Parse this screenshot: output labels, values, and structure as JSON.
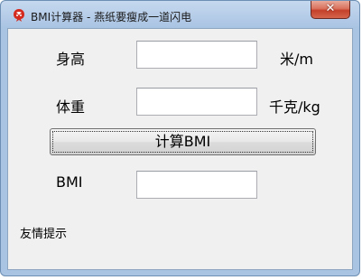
{
  "window": {
    "title": "BMI计算器 - 燕纸要瘦成一道闪电",
    "close_glyph": "✕"
  },
  "icon": "red-dragon-app-icon",
  "form": {
    "height_label": "身高",
    "height_value": "",
    "height_unit": "米/m",
    "weight_label": "体重",
    "weight_value": "",
    "weight_unit": "千克/kg",
    "calc_button": "计算BMI",
    "bmi_label": "BMI",
    "bmi_value": ""
  },
  "tip_link": "友情提示",
  "colors": {
    "client_bg": "#f0f0f0",
    "frame": "#a9c3e3",
    "close_button": "#c4402a"
  }
}
